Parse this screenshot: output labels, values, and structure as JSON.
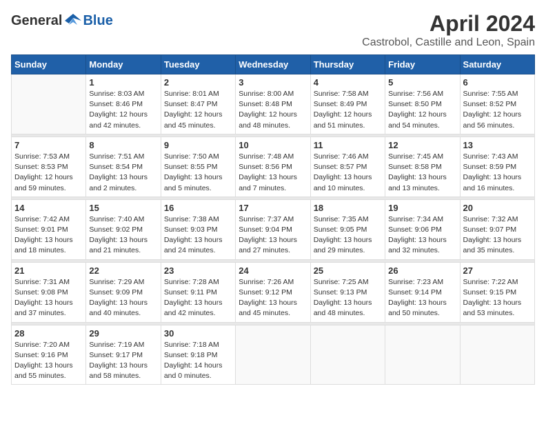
{
  "header": {
    "logo_general": "General",
    "logo_blue": "Blue",
    "title": "April 2024",
    "location": "Castrobol, Castille and Leon, Spain"
  },
  "calendar": {
    "weekdays": [
      "Sunday",
      "Monday",
      "Tuesday",
      "Wednesday",
      "Thursday",
      "Friday",
      "Saturday"
    ],
    "weeks": [
      [
        {
          "day": "",
          "info": ""
        },
        {
          "day": "1",
          "info": "Sunrise: 8:03 AM\nSunset: 8:46 PM\nDaylight: 12 hours\nand 42 minutes."
        },
        {
          "day": "2",
          "info": "Sunrise: 8:01 AM\nSunset: 8:47 PM\nDaylight: 12 hours\nand 45 minutes."
        },
        {
          "day": "3",
          "info": "Sunrise: 8:00 AM\nSunset: 8:48 PM\nDaylight: 12 hours\nand 48 minutes."
        },
        {
          "day": "4",
          "info": "Sunrise: 7:58 AM\nSunset: 8:49 PM\nDaylight: 12 hours\nand 51 minutes."
        },
        {
          "day": "5",
          "info": "Sunrise: 7:56 AM\nSunset: 8:50 PM\nDaylight: 12 hours\nand 54 minutes."
        },
        {
          "day": "6",
          "info": "Sunrise: 7:55 AM\nSunset: 8:52 PM\nDaylight: 12 hours\nand 56 minutes."
        }
      ],
      [
        {
          "day": "7",
          "info": "Sunrise: 7:53 AM\nSunset: 8:53 PM\nDaylight: 12 hours\nand 59 minutes."
        },
        {
          "day": "8",
          "info": "Sunrise: 7:51 AM\nSunset: 8:54 PM\nDaylight: 13 hours\nand 2 minutes."
        },
        {
          "day": "9",
          "info": "Sunrise: 7:50 AM\nSunset: 8:55 PM\nDaylight: 13 hours\nand 5 minutes."
        },
        {
          "day": "10",
          "info": "Sunrise: 7:48 AM\nSunset: 8:56 PM\nDaylight: 13 hours\nand 7 minutes."
        },
        {
          "day": "11",
          "info": "Sunrise: 7:46 AM\nSunset: 8:57 PM\nDaylight: 13 hours\nand 10 minutes."
        },
        {
          "day": "12",
          "info": "Sunrise: 7:45 AM\nSunset: 8:58 PM\nDaylight: 13 hours\nand 13 minutes."
        },
        {
          "day": "13",
          "info": "Sunrise: 7:43 AM\nSunset: 8:59 PM\nDaylight: 13 hours\nand 16 minutes."
        }
      ],
      [
        {
          "day": "14",
          "info": "Sunrise: 7:42 AM\nSunset: 9:01 PM\nDaylight: 13 hours\nand 18 minutes."
        },
        {
          "day": "15",
          "info": "Sunrise: 7:40 AM\nSunset: 9:02 PM\nDaylight: 13 hours\nand 21 minutes."
        },
        {
          "day": "16",
          "info": "Sunrise: 7:38 AM\nSunset: 9:03 PM\nDaylight: 13 hours\nand 24 minutes."
        },
        {
          "day": "17",
          "info": "Sunrise: 7:37 AM\nSunset: 9:04 PM\nDaylight: 13 hours\nand 27 minutes."
        },
        {
          "day": "18",
          "info": "Sunrise: 7:35 AM\nSunset: 9:05 PM\nDaylight: 13 hours\nand 29 minutes."
        },
        {
          "day": "19",
          "info": "Sunrise: 7:34 AM\nSunset: 9:06 PM\nDaylight: 13 hours\nand 32 minutes."
        },
        {
          "day": "20",
          "info": "Sunrise: 7:32 AM\nSunset: 9:07 PM\nDaylight: 13 hours\nand 35 minutes."
        }
      ],
      [
        {
          "day": "21",
          "info": "Sunrise: 7:31 AM\nSunset: 9:08 PM\nDaylight: 13 hours\nand 37 minutes."
        },
        {
          "day": "22",
          "info": "Sunrise: 7:29 AM\nSunset: 9:09 PM\nDaylight: 13 hours\nand 40 minutes."
        },
        {
          "day": "23",
          "info": "Sunrise: 7:28 AM\nSunset: 9:11 PM\nDaylight: 13 hours\nand 42 minutes."
        },
        {
          "day": "24",
          "info": "Sunrise: 7:26 AM\nSunset: 9:12 PM\nDaylight: 13 hours\nand 45 minutes."
        },
        {
          "day": "25",
          "info": "Sunrise: 7:25 AM\nSunset: 9:13 PM\nDaylight: 13 hours\nand 48 minutes."
        },
        {
          "day": "26",
          "info": "Sunrise: 7:23 AM\nSunset: 9:14 PM\nDaylight: 13 hours\nand 50 minutes."
        },
        {
          "day": "27",
          "info": "Sunrise: 7:22 AM\nSunset: 9:15 PM\nDaylight: 13 hours\nand 53 minutes."
        }
      ],
      [
        {
          "day": "28",
          "info": "Sunrise: 7:20 AM\nSunset: 9:16 PM\nDaylight: 13 hours\nand 55 minutes."
        },
        {
          "day": "29",
          "info": "Sunrise: 7:19 AM\nSunset: 9:17 PM\nDaylight: 13 hours\nand 58 minutes."
        },
        {
          "day": "30",
          "info": "Sunrise: 7:18 AM\nSunset: 9:18 PM\nDaylight: 14 hours\nand 0 minutes."
        },
        {
          "day": "",
          "info": ""
        },
        {
          "day": "",
          "info": ""
        },
        {
          "day": "",
          "info": ""
        },
        {
          "day": "",
          "info": ""
        }
      ]
    ]
  }
}
